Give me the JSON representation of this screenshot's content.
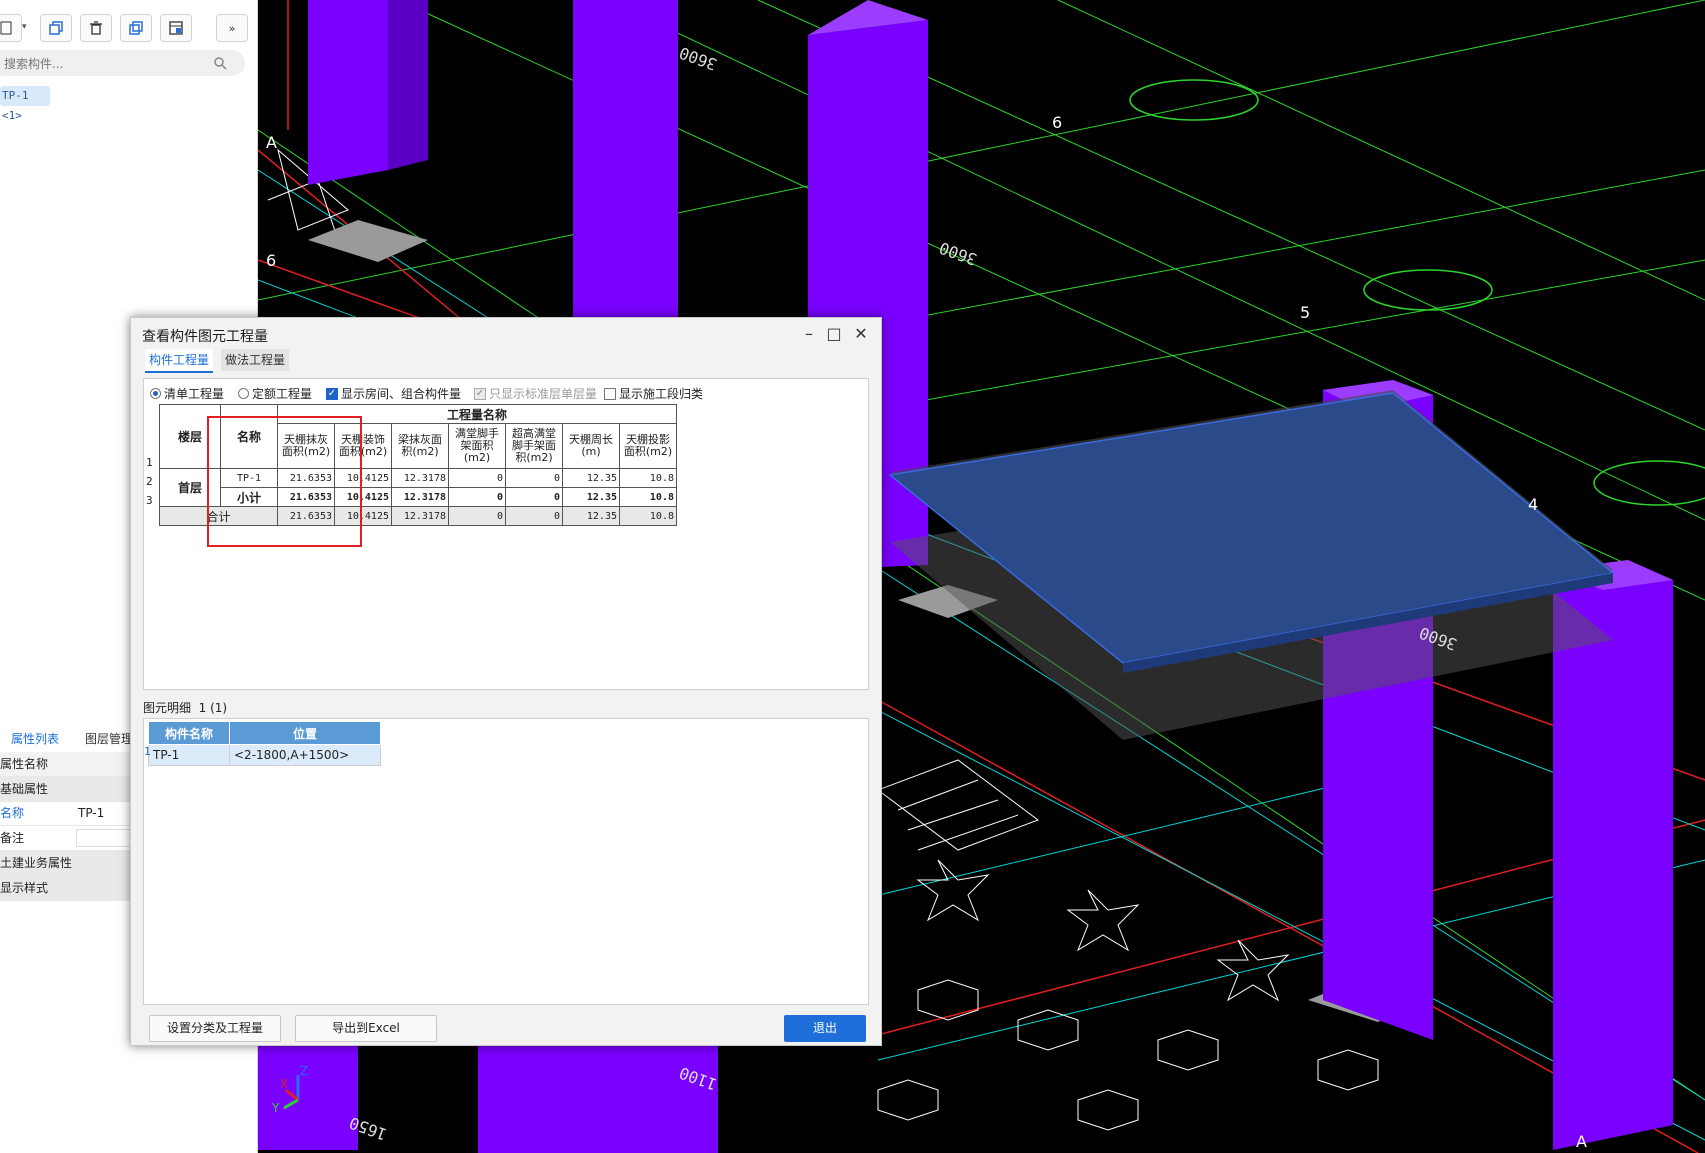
{
  "left_panel": {
    "search_placeholder": "搜索构件...",
    "tree_item": "TP-1 <1>",
    "tabs": [
      "属性列表",
      "图层管理"
    ],
    "props": [
      {
        "label": "属性名称",
        "value": ""
      },
      {
        "label": "基础属性",
        "value": ""
      },
      {
        "label": "名称",
        "value": "TP-1"
      },
      {
        "label": "备注",
        "value": ""
      },
      {
        "label": "土建业务属性",
        "value": ""
      },
      {
        "label": "显示样式",
        "value": ""
      }
    ]
  },
  "dialog": {
    "title": "查看构件图元工程量",
    "tabs": [
      "构件工程量",
      "做法工程量"
    ],
    "options": [
      {
        "label": "清单工程量",
        "type": "radio",
        "checked": true
      },
      {
        "label": "定额工程量",
        "type": "radio",
        "checked": false
      },
      {
        "label": "显示房间、组合构件量",
        "type": "checkbox",
        "checked": true
      },
      {
        "label": "只显示标准层单层量",
        "type": "checkbox",
        "checked": true,
        "disabled": true
      },
      {
        "label": "显示施工段归类",
        "type": "checkbox",
        "checked": false
      }
    ],
    "table": {
      "group_header": "工程量名称",
      "col_floor": "楼层",
      "col_name": "名称",
      "columns": [
        "天棚抹灰面积(m2)",
        "天棚装饰面积(m2)",
        "梁抹灰面积(m2)",
        "满堂脚手架面积(m2)",
        "超高满堂脚手架面积(m2)",
        "天棚周长(m)",
        "天棚投影面积(m2)"
      ],
      "floor": "首层",
      "rows": [
        {
          "num": "1",
          "name": "TP-1",
          "values": [
            "21.6353",
            "10.4125",
            "12.3178",
            "0",
            "0",
            "12.35",
            "10.8"
          ]
        },
        {
          "num": "2",
          "name": "小计",
          "values": [
            "21.6353",
            "10.4125",
            "12.3178",
            "0",
            "0",
            "12.35",
            "10.8"
          ]
        },
        {
          "num": "3",
          "name": "合计",
          "values": [
            "21.6353",
            "10.4125",
            "12.3178",
            "0",
            "0",
            "12.35",
            "10.8"
          ]
        }
      ]
    },
    "detail": {
      "label": "图元明细",
      "count": "1 (1)",
      "columns": [
        "构件名称",
        "位置"
      ],
      "rows": [
        {
          "num": "1",
          "name": "TP-1",
          "position": "<2-1800,A+1500>"
        }
      ]
    },
    "buttons": {
      "set_category": "设置分类及工程量",
      "export": "导出到Excel",
      "exit": "退出"
    }
  },
  "cad": {
    "axis_labels": [
      "A",
      "6",
      "6",
      "5",
      "4",
      "A"
    ],
    "dimension_labels": [
      "3600",
      "3600",
      "3600",
      "1100",
      "1650"
    ],
    "axis_triad": [
      "Z",
      "X",
      "Y"
    ],
    "colors": {
      "column": "#7a00ff",
      "slab": "#2a4a8a",
      "grid_green": "#2cd52c",
      "grid_red": "#e02020",
      "grid_cyan": "#00d8d8"
    }
  }
}
